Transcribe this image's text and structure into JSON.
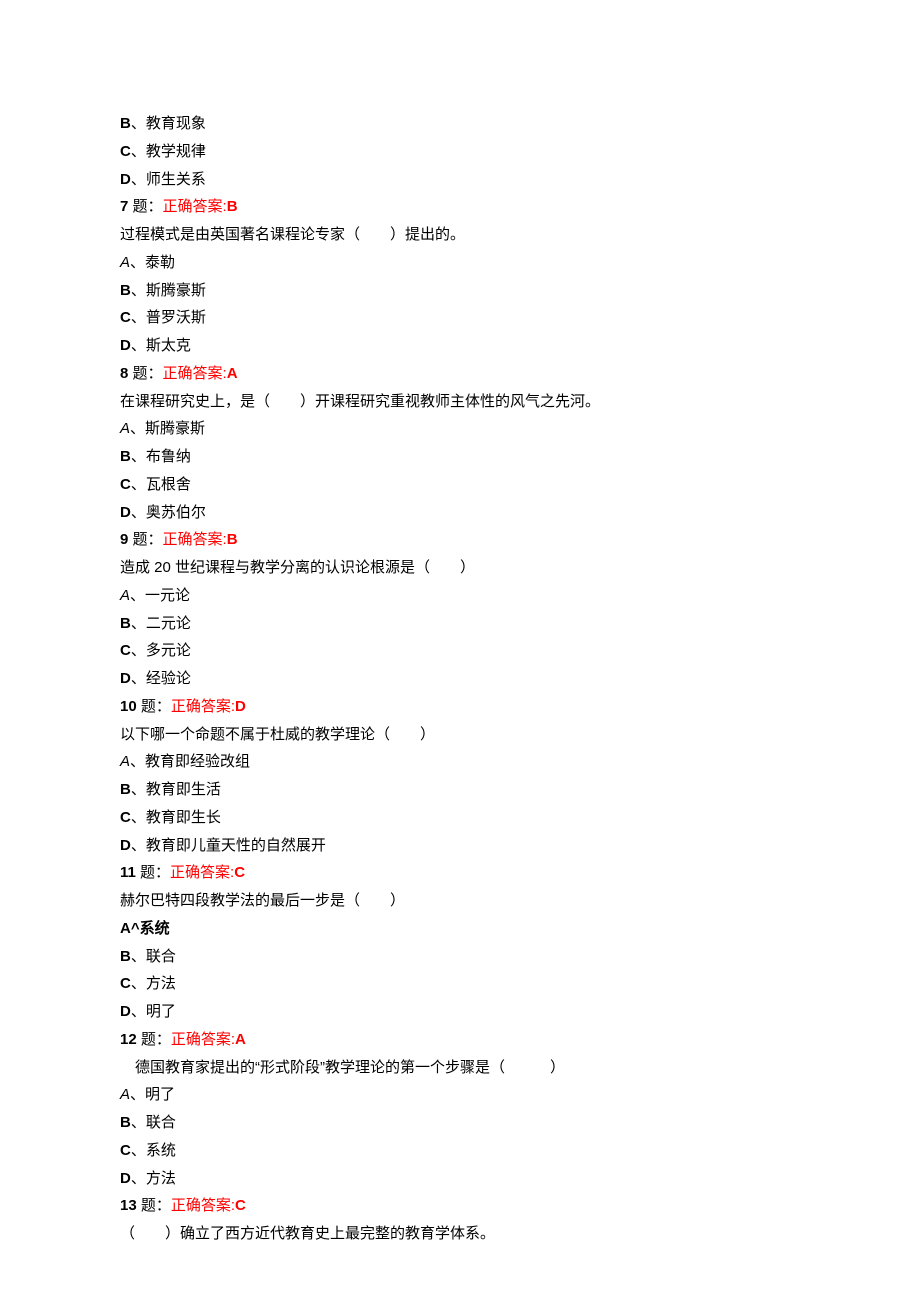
{
  "lines": [
    {
      "type": "option",
      "letter": "B",
      "letterBold": true,
      "text": "、教育现象"
    },
    {
      "type": "option",
      "letter": "C",
      "letterBold": true,
      "text": "、教学规律"
    },
    {
      "type": "option",
      "letter": "D",
      "letterBold": true,
      "text": "、师生关系"
    },
    {
      "type": "answer",
      "number": "7",
      "suffix": " 题：",
      "label": "正确答案:",
      "value": "B"
    },
    {
      "type": "question",
      "text": "过程模式是由英国著名课程论专家（　　）提出的。"
    },
    {
      "type": "option",
      "letter": "A",
      "letterItalic": true,
      "text": "、泰勒"
    },
    {
      "type": "option",
      "letter": "B",
      "letterBold": true,
      "text": "、斯腾豪斯"
    },
    {
      "type": "option",
      "letter": "C",
      "letterBold": true,
      "text": "、普罗沃斯"
    },
    {
      "type": "option",
      "letter": "D",
      "letterBold": true,
      "text": "、斯太克"
    },
    {
      "type": "answer",
      "number": "8",
      "suffix": " 题：",
      "label": "正确答案:",
      "value": "A"
    },
    {
      "type": "question",
      "text": "在课程研究史上，是（　　）开课程研究重视教师主体性的风气之先河。"
    },
    {
      "type": "option",
      "letter": "A",
      "letterItalic": true,
      "text": "、斯腾豪斯"
    },
    {
      "type": "option",
      "letter": "B",
      "letterBold": true,
      "text": "、布鲁纳"
    },
    {
      "type": "option",
      "letter": "C",
      "letterBold": true,
      "text": "、瓦根舍"
    },
    {
      "type": "option",
      "letter": "D",
      "letterBold": true,
      "text": "、奥苏伯尔"
    },
    {
      "type": "answer",
      "number": "9",
      "suffix": " 题：",
      "label": "正确答案:",
      "value": "B"
    },
    {
      "type": "question",
      "text": "造成 20 世纪课程与教学分离的认识论根源是（　　）"
    },
    {
      "type": "option",
      "letter": "A",
      "letterItalic": true,
      "text": "、一元论"
    },
    {
      "type": "option",
      "letter": "B",
      "letterBold": true,
      "text": "、二元论"
    },
    {
      "type": "option",
      "letter": "C",
      "letterBold": true,
      "text": "、多元论"
    },
    {
      "type": "option",
      "letter": "D",
      "letterBold": true,
      "text": "、经验论"
    },
    {
      "type": "answer",
      "number": "10",
      "suffix": " 题：",
      "label": "正确答案:",
      "value": "D"
    },
    {
      "type": "question",
      "text": "以下哪一个命题不属于杜威的教学理论（　　）"
    },
    {
      "type": "option",
      "letter": "A",
      "letterItalic": true,
      "text": "、教育即经验改组"
    },
    {
      "type": "option",
      "letter": "B",
      "letterBold": true,
      "text": "、教育即生活"
    },
    {
      "type": "option",
      "letter": "C",
      "letterBold": true,
      "text": "、教育即生长"
    },
    {
      "type": "option",
      "letter": "D",
      "letterBold": true,
      "text": "、教育即儿童天性的自然展开"
    },
    {
      "type": "answer",
      "number": "11",
      "suffix": " 题：",
      "label": "正确答案:",
      "value": "C"
    },
    {
      "type": "question",
      "text": "赫尔巴特四段教学法的最后一步是（　　）"
    },
    {
      "type": "option-raw",
      "text": "A^系统",
      "bold": true
    },
    {
      "type": "option",
      "letter": "B",
      "letterBold": true,
      "text": "、联合"
    },
    {
      "type": "option",
      "letter": "C",
      "letterBold": true,
      "text": "、方法"
    },
    {
      "type": "option",
      "letter": "D",
      "letterBold": true,
      "text": "、明了"
    },
    {
      "type": "answer",
      "number": "12",
      "suffix": " 题：",
      "label": "正确答案:",
      "value": "A"
    },
    {
      "type": "question",
      "indent": true,
      "text": "德国教育家提出的“形式阶段”教学理论的第一个步骤是（　　　）"
    },
    {
      "type": "option",
      "letter": "A",
      "letterItalic": true,
      "text": "、明了"
    },
    {
      "type": "option",
      "letter": "B",
      "letterBold": true,
      "text": "、联合"
    },
    {
      "type": "option",
      "letter": "C",
      "letterBold": true,
      "text": "、系统"
    },
    {
      "type": "option",
      "letter": "D",
      "letterBold": true,
      "text": "、方法"
    },
    {
      "type": "answer",
      "number": "13",
      "suffix": " 题：",
      "label": "正确答案:",
      "value": "C"
    },
    {
      "type": "question",
      "text": "（　　）确立了西方近代教育史上最完整的教育学体系。"
    }
  ]
}
